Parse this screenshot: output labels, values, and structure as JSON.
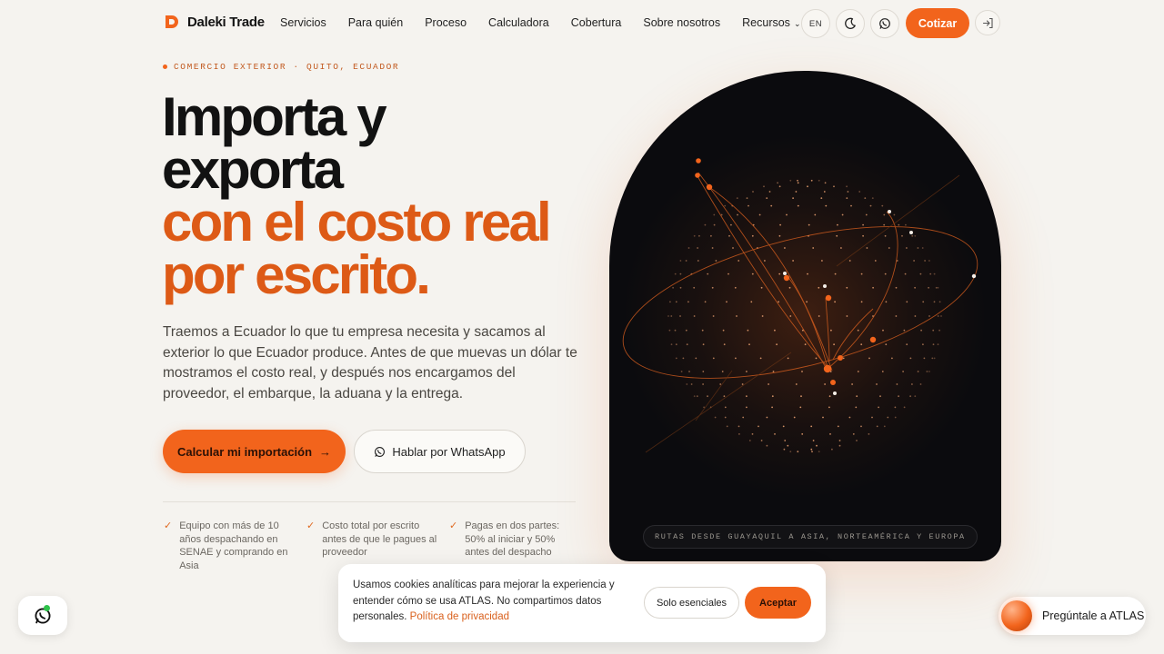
{
  "brand": {
    "name": "Daleki Trade",
    "accent": "#f2641c"
  },
  "nav": {
    "links": [
      "Servicios",
      "Para quién",
      "Proceso",
      "Calculadora",
      "Cobertura",
      "Sobre nosotros",
      "Recursos"
    ],
    "lang_label": "EN",
    "cta_label": "Cotizar",
    "icons": [
      "moon-icon",
      "whatsapp-icon",
      "login-icon",
      "chevron-down-icon"
    ]
  },
  "hero": {
    "eyebrow": "COMERCIO EXTERIOR · QUITO, ECUADOR",
    "headline_dark_1": "Importa y",
    "headline_dark_2": "exporta",
    "headline_accent_1": "con el costo real",
    "headline_accent_2": "por escrito.",
    "lead": "Traemos a Ecuador lo que tu empresa necesita y sacamos al exterior lo que Ecuador produce. Antes de que muevas un dólar te mostramos el costo real, y después nos encargamos del proveedor, el embarque, la aduana y la entrega.",
    "primary_cta": "Calcular mi importación",
    "secondary_cta": "Hablar por WhatsApp",
    "features": [
      "Equipo con más de 10 años despachando en SENAE y comprando en Asia",
      "Costo total por escrito antes de que le pagues al proveedor",
      "Pagas en dos partes: 50% al iniciar y 50% antes del despacho"
    ]
  },
  "globe_card": {
    "caption": "RUTAS DESDE GUAYAQUIL A ASIA, NORTEAMÉRICA Y EUROPA"
  },
  "cookie_banner": {
    "text": "Usamos cookies analíticas para mejorar la experiencia y entender cómo se usa ATLAS. No compartimos datos personales.",
    "policy_link": "Política de privacidad",
    "essential_label": "Solo esenciales",
    "accept_label": "Aceptar"
  },
  "assistant": {
    "label": "Pregúntale a ATLAS"
  }
}
